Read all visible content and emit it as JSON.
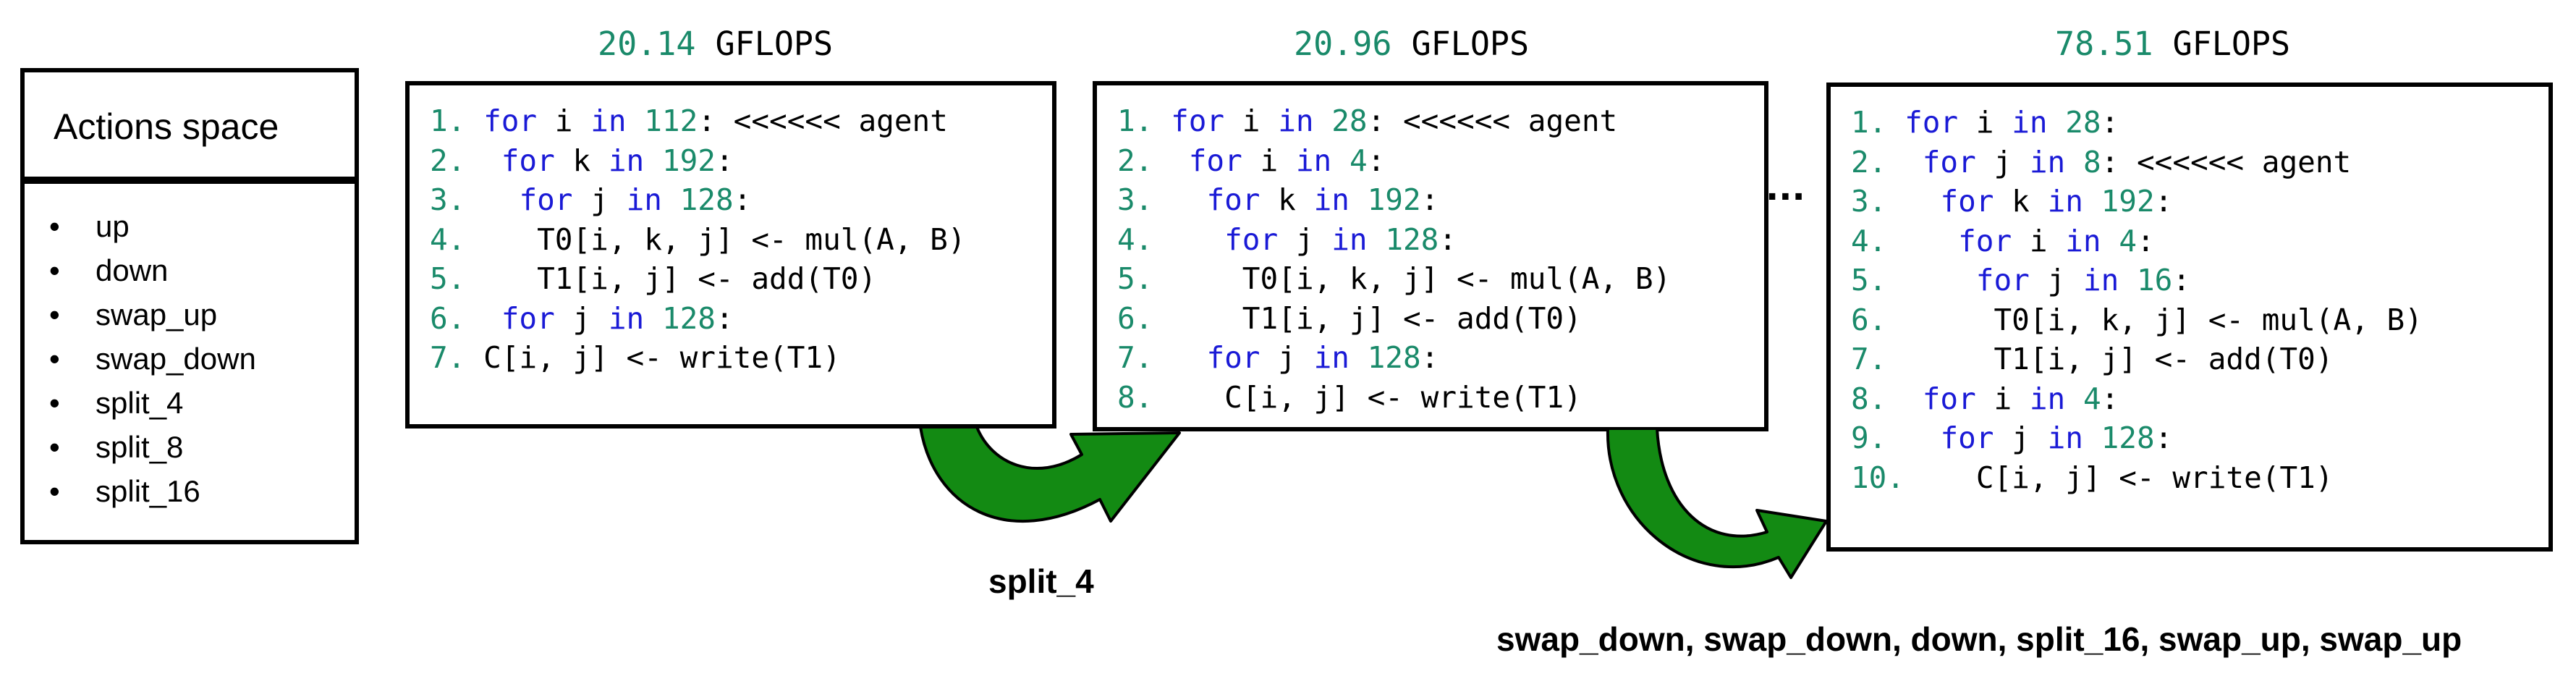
{
  "actions": {
    "title": "Actions space",
    "items": [
      "up",
      "down",
      "swap_up",
      "swap_down",
      "split_4",
      "split_8",
      "split_16"
    ]
  },
  "panels": [
    {
      "gflops_value": "20.14",
      "gflops_unit": "GFLOPS",
      "lines": [
        {
          "num": "1.",
          "indent": 0,
          "tokens": [
            {
              "t": "kw",
              "v": "for"
            },
            {
              "t": "p",
              "v": " i "
            },
            {
              "t": "kw",
              "v": "in"
            },
            {
              "t": "p",
              "v": " "
            },
            {
              "t": "n",
              "v": "112"
            },
            {
              "t": "p",
              "v": ": <<<<<< agent"
            }
          ]
        },
        {
          "num": "2.",
          "indent": 1,
          "tokens": [
            {
              "t": "kw",
              "v": "for"
            },
            {
              "t": "p",
              "v": " k "
            },
            {
              "t": "kw",
              "v": "in"
            },
            {
              "t": "p",
              "v": " "
            },
            {
              "t": "n",
              "v": "192"
            },
            {
              "t": "p",
              "v": ":"
            }
          ]
        },
        {
          "num": "3.",
          "indent": 2,
          "tokens": [
            {
              "t": "kw",
              "v": "for"
            },
            {
              "t": "p",
              "v": " j "
            },
            {
              "t": "kw",
              "v": "in"
            },
            {
              "t": "p",
              "v": " "
            },
            {
              "t": "n",
              "v": "128"
            },
            {
              "t": "p",
              "v": ":"
            }
          ]
        },
        {
          "num": "4.",
          "indent": 3,
          "tokens": [
            {
              "t": "p",
              "v": "T0[i, k, j] <- mul(A, B)"
            }
          ]
        },
        {
          "num": "5.",
          "indent": 3,
          "tokens": [
            {
              "t": "p",
              "v": "T1[i, j] <- add(T0)"
            }
          ]
        },
        {
          "num": "6.",
          "indent": 1,
          "tokens": [
            {
              "t": "kw",
              "v": "for"
            },
            {
              "t": "p",
              "v": " j "
            },
            {
              "t": "kw",
              "v": "in"
            },
            {
              "t": "p",
              "v": " "
            },
            {
              "t": "n",
              "v": "128"
            },
            {
              "t": "p",
              "v": ":"
            }
          ]
        },
        {
          "num": "7.",
          "indent": 0,
          "tokens": [
            {
              "t": "p",
              "v": "C[i, j] <- write(T1)"
            }
          ]
        }
      ]
    },
    {
      "gflops_value": "20.96",
      "gflops_unit": "GFLOPS",
      "lines": [
        {
          "num": "1.",
          "indent": 0,
          "tokens": [
            {
              "t": "kw",
              "v": "for"
            },
            {
              "t": "p",
              "v": " i "
            },
            {
              "t": "kw",
              "v": "in"
            },
            {
              "t": "p",
              "v": " "
            },
            {
              "t": "n",
              "v": "28"
            },
            {
              "t": "p",
              "v": ": <<<<<< agent"
            }
          ]
        },
        {
          "num": "2.",
          "indent": 1,
          "tokens": [
            {
              "t": "kw",
              "v": "for"
            },
            {
              "t": "p",
              "v": " i "
            },
            {
              "t": "kw",
              "v": "in"
            },
            {
              "t": "p",
              "v": " "
            },
            {
              "t": "n",
              "v": "4"
            },
            {
              "t": "p",
              "v": ":"
            }
          ]
        },
        {
          "num": "3.",
          "indent": 2,
          "tokens": [
            {
              "t": "kw",
              "v": "for"
            },
            {
              "t": "p",
              "v": " k "
            },
            {
              "t": "kw",
              "v": "in"
            },
            {
              "t": "p",
              "v": " "
            },
            {
              "t": "n",
              "v": "192"
            },
            {
              "t": "p",
              "v": ":"
            }
          ]
        },
        {
          "num": "4.",
          "indent": 3,
          "tokens": [
            {
              "t": "kw",
              "v": "for"
            },
            {
              "t": "p",
              "v": " j "
            },
            {
              "t": "kw",
              "v": "in"
            },
            {
              "t": "p",
              "v": " "
            },
            {
              "t": "n",
              "v": "128"
            },
            {
              "t": "p",
              "v": ":"
            }
          ]
        },
        {
          "num": "5.",
          "indent": 4,
          "tokens": [
            {
              "t": "p",
              "v": "T0[i, k, j] <- mul(A, B)"
            }
          ]
        },
        {
          "num": "6.",
          "indent": 4,
          "tokens": [
            {
              "t": "p",
              "v": "T1[i, j] <- add(T0)"
            }
          ]
        },
        {
          "num": "7.",
          "indent": 2,
          "tokens": [
            {
              "t": "kw",
              "v": "for"
            },
            {
              "t": "p",
              "v": " j "
            },
            {
              "t": "kw",
              "v": "in"
            },
            {
              "t": "p",
              "v": " "
            },
            {
              "t": "n",
              "v": "128"
            },
            {
              "t": "p",
              "v": ":"
            }
          ]
        },
        {
          "num": "8.",
          "indent": 3,
          "tokens": [
            {
              "t": "p",
              "v": "C[i, j] <- write(T1)"
            }
          ]
        }
      ]
    },
    {
      "gflops_value": "78.51",
      "gflops_unit": "GFLOPS",
      "lines": [
        {
          "num": "1.",
          "indent": 0,
          "tokens": [
            {
              "t": "kw",
              "v": "for"
            },
            {
              "t": "p",
              "v": " i "
            },
            {
              "t": "kw",
              "v": "in"
            },
            {
              "t": "p",
              "v": " "
            },
            {
              "t": "n",
              "v": "28"
            },
            {
              "t": "p",
              "v": ":"
            }
          ]
        },
        {
          "num": "2.",
          "indent": 1,
          "tokens": [
            {
              "t": "kw",
              "v": "for"
            },
            {
              "t": "p",
              "v": " j "
            },
            {
              "t": "kw",
              "v": "in"
            },
            {
              "t": "p",
              "v": " "
            },
            {
              "t": "n",
              "v": "8"
            },
            {
              "t": "p",
              "v": ": <<<<<< agent"
            }
          ]
        },
        {
          "num": "3.",
          "indent": 2,
          "tokens": [
            {
              "t": "kw",
              "v": "for"
            },
            {
              "t": "p",
              "v": " k "
            },
            {
              "t": "kw",
              "v": "in"
            },
            {
              "t": "p",
              "v": " "
            },
            {
              "t": "n",
              "v": "192"
            },
            {
              "t": "p",
              "v": ":"
            }
          ]
        },
        {
          "num": "4.",
          "indent": 3,
          "tokens": [
            {
              "t": "kw",
              "v": "for"
            },
            {
              "t": "p",
              "v": " i "
            },
            {
              "t": "kw",
              "v": "in"
            },
            {
              "t": "p",
              "v": " "
            },
            {
              "t": "n",
              "v": "4"
            },
            {
              "t": "p",
              "v": ":"
            }
          ]
        },
        {
          "num": "5.",
          "indent": 4,
          "tokens": [
            {
              "t": "kw",
              "v": "for"
            },
            {
              "t": "p",
              "v": " j "
            },
            {
              "t": "kw",
              "v": "in"
            },
            {
              "t": "p",
              "v": " "
            },
            {
              "t": "n",
              "v": "16"
            },
            {
              "t": "p",
              "v": ":"
            }
          ]
        },
        {
          "num": "6.",
          "indent": 5,
          "tokens": [
            {
              "t": "p",
              "v": "T0[i, k, j] <- mul(A, B)"
            }
          ]
        },
        {
          "num": "7.",
          "indent": 5,
          "tokens": [
            {
              "t": "p",
              "v": "T1[i, j] <- add(T0)"
            }
          ]
        },
        {
          "num": "8.",
          "indent": 1,
          "tokens": [
            {
              "t": "kw",
              "v": "for"
            },
            {
              "t": "p",
              "v": " i "
            },
            {
              "t": "kw",
              "v": "in"
            },
            {
              "t": "p",
              "v": " "
            },
            {
              "t": "n",
              "v": "4"
            },
            {
              "t": "p",
              "v": ":"
            }
          ]
        },
        {
          "num": "9.",
          "indent": 2,
          "tokens": [
            {
              "t": "kw",
              "v": "for"
            },
            {
              "t": "p",
              "v": " j "
            },
            {
              "t": "kw",
              "v": "in"
            },
            {
              "t": "p",
              "v": " "
            },
            {
              "t": "n",
              "v": "128"
            },
            {
              "t": "p",
              "v": ":"
            }
          ]
        },
        {
          "num": "10.",
          "indent": 3,
          "tokens": [
            {
              "t": "p",
              "v": "C[i, j] <- write(T1)"
            }
          ]
        }
      ]
    }
  ],
  "ellipsis": "...",
  "transitions": [
    {
      "label": "split_4"
    },
    {
      "label": "swap_down, swap_down, down, split_16, swap_up, swap_up"
    }
  ],
  "colors": {
    "keyword": "#1a1ad6",
    "number": "#1a8a6a",
    "arrow_fill": "#138a13",
    "arrow_stroke": "#000000"
  }
}
